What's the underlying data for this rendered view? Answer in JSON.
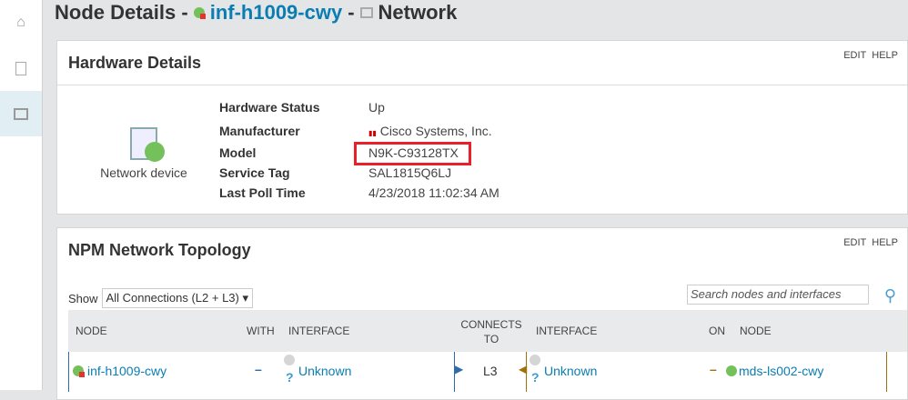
{
  "sidebar": {
    "items": [
      {
        "icon": "home-icon"
      },
      {
        "icon": "report-icon"
      },
      {
        "icon": "network-icon",
        "active": true
      }
    ]
  },
  "header": {
    "prefix": "Node Details - ",
    "node": "inf-h1009-cwy",
    "sep": " - ",
    "view": "Network"
  },
  "hardware": {
    "title": "Hardware Details",
    "edit": "EDIT",
    "help": "HELP",
    "device_label": "Network device",
    "fields": [
      {
        "k": "Hardware Status",
        "v": "Up"
      },
      {
        "k": "Manufacturer",
        "v": "Cisco Systems, Inc."
      },
      {
        "k": "Model",
        "v": "N9K-C93128TX"
      },
      {
        "k": "Service Tag",
        "v": "SAL1815Q6LJ"
      },
      {
        "k": "Last Poll Time",
        "v": "4/23/2018 11:02:34 AM"
      }
    ]
  },
  "topology": {
    "title": "NPM Network Topology",
    "edit": "EDIT",
    "help": "HELP",
    "show_label": "Show",
    "show_value": "All Connections (L2 + L3)",
    "search_placeholder": "Search nodes and interfaces",
    "columns": [
      "NODE",
      "WITH",
      "INTERFACE",
      "CONNECTS TO",
      "INTERFACE",
      "ON",
      "NODE"
    ],
    "rows": [
      {
        "node": "inf-h1009-cwy",
        "with": "–",
        "interface": "Unknown",
        "connects": "L3",
        "interface2": "Unknown",
        "on": "–",
        "node2": "mds-ls002-cwy"
      }
    ]
  }
}
